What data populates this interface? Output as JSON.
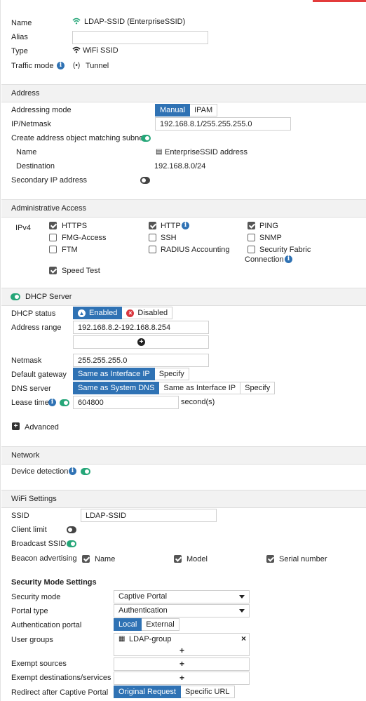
{
  "interface": {
    "name_label": "Name",
    "name_value": "LDAP-SSID (EnterpriseSSID)",
    "alias_label": "Alias",
    "alias_value": "",
    "type_label": "Type",
    "type_value": "WiFi SSID",
    "traffic_mode_label": "Traffic mode",
    "traffic_mode_value": "Tunnel"
  },
  "address": {
    "section_title": "Address",
    "addressing_mode_label": "Addressing mode",
    "addressing_mode_options": [
      "Manual",
      "IPAM"
    ],
    "addressing_mode_selected": "Manual",
    "ip_netmask_label": "IP/Netmask",
    "ip_netmask_value": "192.168.8.1/255.255.255.0",
    "create_object_label": "Create address object matching subnet",
    "create_object_enabled": true,
    "object_name_label": "Name",
    "object_name_value": "EnterpriseSSID address",
    "destination_label": "Destination",
    "destination_value": "192.168.8.0/24",
    "secondary_ip_label": "Secondary IP address",
    "secondary_ip_enabled": false
  },
  "admin_access": {
    "section_title": "Administrative Access",
    "ipv4_label": "IPv4",
    "options": [
      {
        "label": "HTTPS",
        "checked": true
      },
      {
        "label": "HTTP",
        "checked": true
      },
      {
        "label": "PING",
        "checked": true
      },
      {
        "label": "FMG-Access",
        "checked": false
      },
      {
        "label": "SSH",
        "checked": false
      },
      {
        "label": "SNMP",
        "checked": false
      },
      {
        "label": "FTM",
        "checked": false
      },
      {
        "label": "RADIUS Accounting",
        "checked": false
      },
      {
        "label": "Security Fabric",
        "label2": "Connection",
        "checked": false
      },
      {
        "label": "Speed Test",
        "checked": true
      }
    ]
  },
  "dhcp": {
    "section_title": "DHCP Server",
    "enabled": true,
    "status_label": "DHCP status",
    "status_enabled_label": "Enabled",
    "status_disabled_label": "Disabled",
    "address_range_label": "Address range",
    "address_range_value": "192.168.8.2-192.168.8.254",
    "netmask_label": "Netmask",
    "netmask_value": "255.255.255.0",
    "default_gateway_label": "Default gateway",
    "default_gateway_options": [
      "Same as Interface IP",
      "Specify"
    ],
    "dns_server_label": "DNS server",
    "dns_server_options": [
      "Same as System DNS",
      "Same as Interface IP",
      "Specify"
    ],
    "lease_time_label": "Lease time",
    "lease_time_value": "604800",
    "lease_time_unit": "second(s)",
    "advanced_label": "Advanced"
  },
  "network": {
    "section_title": "Network",
    "device_detection_label": "Device detection",
    "device_detection_enabled": true
  },
  "wifi": {
    "section_title": "WiFi Settings",
    "ssid_label": "SSID",
    "ssid_value": "LDAP-SSID",
    "client_limit_label": "Client limit",
    "broadcast_ssid_label": "Broadcast SSID",
    "beacon_label": "Beacon advertising",
    "beacon_options": [
      {
        "label": "Name",
        "checked": true
      },
      {
        "label": "Model",
        "checked": true
      },
      {
        "label": "Serial number",
        "checked": true
      }
    ]
  },
  "security": {
    "title": "Security Mode Settings",
    "security_mode_label": "Security mode",
    "security_mode_value": "Captive Portal",
    "portal_type_label": "Portal type",
    "portal_type_value": "Authentication",
    "auth_portal_label": "Authentication portal",
    "auth_portal_options": [
      "Local",
      "External"
    ],
    "user_groups_label": "User groups",
    "user_group_value": "LDAP-group",
    "exempt_sources_label": "Exempt sources",
    "exempt_destinations_label": "Exempt destinations/services",
    "redirect_label": "Redirect after Captive Portal",
    "redirect_options": [
      "Original Request",
      "Specific URL"
    ]
  },
  "colors": {
    "accent_blue": "#2f72b4",
    "toggle_on": "#25a678",
    "toggle_off": "#444444",
    "disabled_red": "#d9363e"
  }
}
